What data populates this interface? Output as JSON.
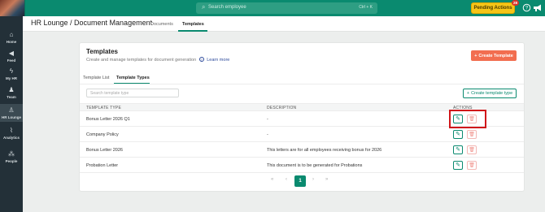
{
  "topbar": {
    "search_placeholder": "Search employee",
    "search_shortcut": "Ctrl + K",
    "pending_label": "Pending Actions",
    "pending_count": "28"
  },
  "sidebar": {
    "items": [
      {
        "label": "Home",
        "icon": "home-icon",
        "glyph": "⌂"
      },
      {
        "label": "Feed",
        "icon": "megaphone-icon",
        "glyph": "◀"
      },
      {
        "label": "My HR",
        "icon": "bolt-icon",
        "glyph": "ϟ"
      },
      {
        "label": "Team",
        "icon": "team-icon",
        "glyph": "♟"
      },
      {
        "label": "HR Lounge",
        "icon": "people-icon",
        "glyph": "♙"
      },
      {
        "label": "Analytics",
        "icon": "chart-icon",
        "glyph": "⌇"
      },
      {
        "label": "People",
        "icon": "org-icon",
        "glyph": "⁂"
      }
    ]
  },
  "header": {
    "title": "HR Lounge  /  Document Management",
    "tabs": [
      "Documents",
      "Templates"
    ]
  },
  "card": {
    "title": "Templates",
    "subtitle": "Create and manage templates for document generation",
    "help_glyph": "?",
    "learn_more": "Learn more",
    "create_button": "Create Template",
    "subtabs": [
      "Template List",
      "Template Types"
    ],
    "search_placeholder": "Search template type",
    "create_type_button": "Create template type"
  },
  "table": {
    "columns": [
      "TEMPLATE TYPE",
      "DESCRIPTION",
      "ACTIONS"
    ],
    "rows": [
      {
        "type": "Bonus Letter 2026 Q1",
        "description": "-"
      },
      {
        "type": "Company Policy",
        "description": "-"
      },
      {
        "type": "Bonus Letter 2026",
        "description": "This letters are for all employees receiving bonus for 2026"
      },
      {
        "type": "Probation Letter",
        "description": "This document is to be generated for Probations"
      }
    ]
  },
  "pagination": {
    "first": "«",
    "prev": "‹",
    "current": "1",
    "next": "›",
    "last": "»"
  },
  "colors": {
    "brand": "#0a8a6f",
    "sidebar": "#233038",
    "primary_action": "#f26e50",
    "highlight": "#d0161a"
  }
}
